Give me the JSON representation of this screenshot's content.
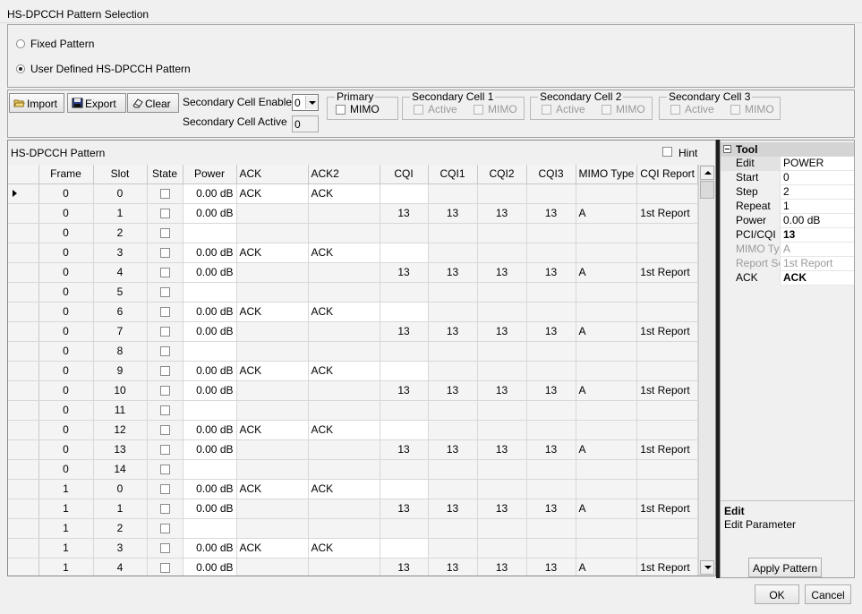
{
  "window": {
    "title": "HS-DPCCH Pattern Selection"
  },
  "pattern_type": {
    "options": [
      {
        "label": "Fixed Pattern",
        "selected": false
      },
      {
        "label": "User Defined HS-DPCCH Pattern",
        "selected": true
      }
    ]
  },
  "toolbar": {
    "import_label": "Import",
    "export_label": "Export",
    "clear_label": "Clear",
    "sec_cell_enabled_label": "Secondary Cell Enabled",
    "sec_cell_enabled_value": "0",
    "sec_cell_active_label": "Secondary Cell Active",
    "sec_cell_active_value": "0",
    "primary": {
      "title": "Primary",
      "mimo": "MIMO"
    },
    "secondary_cells": [
      {
        "title": "Secondary Cell 1",
        "active": "Active",
        "mimo": "MIMO"
      },
      {
        "title": "Secondary Cell 2",
        "active": "Active",
        "mimo": "MIMO"
      },
      {
        "title": "Secondary Cell 3",
        "active": "Active",
        "mimo": "MIMO"
      }
    ]
  },
  "grid": {
    "caption": "HS-DPCCH Pattern",
    "hint_label": "Hint",
    "columns": [
      "Frame",
      "Slot",
      "State",
      "Power",
      "ACK",
      "ACK2",
      "CQI",
      "CQI1",
      "CQI2",
      "CQI3",
      "MIMO Type",
      "CQI Report"
    ],
    "rows": [
      {
        "frame": "0",
        "slot": "0",
        "power": "0.00 dB",
        "ack": "ACK",
        "ack2": "ACK",
        "cqi": "",
        "cqi1": "",
        "cqi2": "",
        "cqi3": "",
        "mimo": "",
        "report": ""
      },
      {
        "frame": "0",
        "slot": "1",
        "power": "0.00 dB",
        "ack": "",
        "ack2": "",
        "cqi": "13",
        "cqi1": "13",
        "cqi2": "13",
        "cqi3": "13",
        "mimo": "A",
        "report": "1st Report"
      },
      {
        "frame": "0",
        "slot": "2",
        "power": "",
        "ack": "",
        "ack2": "",
        "cqi": "",
        "cqi1": "",
        "cqi2": "",
        "cqi3": "",
        "mimo": "",
        "report": ""
      },
      {
        "frame": "0",
        "slot": "3",
        "power": "0.00 dB",
        "ack": "ACK",
        "ack2": "ACK",
        "cqi": "",
        "cqi1": "",
        "cqi2": "",
        "cqi3": "",
        "mimo": "",
        "report": ""
      },
      {
        "frame": "0",
        "slot": "4",
        "power": "0.00 dB",
        "ack": "",
        "ack2": "",
        "cqi": "13",
        "cqi1": "13",
        "cqi2": "13",
        "cqi3": "13",
        "mimo": "A",
        "report": "1st Report"
      },
      {
        "frame": "0",
        "slot": "5",
        "power": "",
        "ack": "",
        "ack2": "",
        "cqi": "",
        "cqi1": "",
        "cqi2": "",
        "cqi3": "",
        "mimo": "",
        "report": ""
      },
      {
        "frame": "0",
        "slot": "6",
        "power": "0.00 dB",
        "ack": "ACK",
        "ack2": "ACK",
        "cqi": "",
        "cqi1": "",
        "cqi2": "",
        "cqi3": "",
        "mimo": "",
        "report": ""
      },
      {
        "frame": "0",
        "slot": "7",
        "power": "0.00 dB",
        "ack": "",
        "ack2": "",
        "cqi": "13",
        "cqi1": "13",
        "cqi2": "13",
        "cqi3": "13",
        "mimo": "A",
        "report": "1st Report"
      },
      {
        "frame": "0",
        "slot": "8",
        "power": "",
        "ack": "",
        "ack2": "",
        "cqi": "",
        "cqi1": "",
        "cqi2": "",
        "cqi3": "",
        "mimo": "",
        "report": ""
      },
      {
        "frame": "0",
        "slot": "9",
        "power": "0.00 dB",
        "ack": "ACK",
        "ack2": "ACK",
        "cqi": "",
        "cqi1": "",
        "cqi2": "",
        "cqi3": "",
        "mimo": "",
        "report": ""
      },
      {
        "frame": "0",
        "slot": "10",
        "power": "0.00 dB",
        "ack": "",
        "ack2": "",
        "cqi": "13",
        "cqi1": "13",
        "cqi2": "13",
        "cqi3": "13",
        "mimo": "A",
        "report": "1st Report"
      },
      {
        "frame": "0",
        "slot": "11",
        "power": "",
        "ack": "",
        "ack2": "",
        "cqi": "",
        "cqi1": "",
        "cqi2": "",
        "cqi3": "",
        "mimo": "",
        "report": ""
      },
      {
        "frame": "0",
        "slot": "12",
        "power": "0.00 dB",
        "ack": "ACK",
        "ack2": "ACK",
        "cqi": "",
        "cqi1": "",
        "cqi2": "",
        "cqi3": "",
        "mimo": "",
        "report": ""
      },
      {
        "frame": "0",
        "slot": "13",
        "power": "0.00 dB",
        "ack": "",
        "ack2": "",
        "cqi": "13",
        "cqi1": "13",
        "cqi2": "13",
        "cqi3": "13",
        "mimo": "A",
        "report": "1st Report"
      },
      {
        "frame": "0",
        "slot": "14",
        "power": "",
        "ack": "",
        "ack2": "",
        "cqi": "",
        "cqi1": "",
        "cqi2": "",
        "cqi3": "",
        "mimo": "",
        "report": ""
      },
      {
        "frame": "1",
        "slot": "0",
        "power": "0.00 dB",
        "ack": "ACK",
        "ack2": "ACK",
        "cqi": "",
        "cqi1": "",
        "cqi2": "",
        "cqi3": "",
        "mimo": "",
        "report": ""
      },
      {
        "frame": "1",
        "slot": "1",
        "power": "0.00 dB",
        "ack": "",
        "ack2": "",
        "cqi": "13",
        "cqi1": "13",
        "cqi2": "13",
        "cqi3": "13",
        "mimo": "A",
        "report": "1st Report"
      },
      {
        "frame": "1",
        "slot": "2",
        "power": "",
        "ack": "",
        "ack2": "",
        "cqi": "",
        "cqi1": "",
        "cqi2": "",
        "cqi3": "",
        "mimo": "",
        "report": ""
      },
      {
        "frame": "1",
        "slot": "3",
        "power": "0.00 dB",
        "ack": "ACK",
        "ack2": "ACK",
        "cqi": "",
        "cqi1": "",
        "cqi2": "",
        "cqi3": "",
        "mimo": "",
        "report": ""
      },
      {
        "frame": "1",
        "slot": "4",
        "power": "0.00 dB",
        "ack": "",
        "ack2": "",
        "cqi": "13",
        "cqi1": "13",
        "cqi2": "13",
        "cqi3": "13",
        "mimo": "A",
        "report": "1st Report"
      }
    ]
  },
  "tool": {
    "title": "Tool",
    "properties": [
      {
        "name": "Edit",
        "value": "POWER",
        "disabled": false,
        "bold": false
      },
      {
        "name": "Start",
        "value": "0",
        "disabled": false,
        "bold": false
      },
      {
        "name": "Step",
        "value": "2",
        "disabled": false,
        "bold": false
      },
      {
        "name": "Repeat",
        "value": "1",
        "disabled": false,
        "bold": false
      },
      {
        "name": "Power",
        "value": "0.00 dB",
        "disabled": false,
        "bold": false
      },
      {
        "name": "PCI/CQI",
        "value": "13",
        "disabled": false,
        "bold": true
      },
      {
        "name": "MIMO Type",
        "value": "A",
        "disabled": true,
        "bold": false
      },
      {
        "name": "Report Se",
        "value": "1st Report",
        "disabled": true,
        "bold": false
      },
      {
        "name": "ACK",
        "value": "ACK",
        "disabled": false,
        "bold": true
      }
    ],
    "desc_title": "Edit",
    "desc_text": "Edit Parameter",
    "apply_label": "Apply Pattern"
  },
  "footer": {
    "ok_label": "OK",
    "cancel_label": "Cancel"
  }
}
